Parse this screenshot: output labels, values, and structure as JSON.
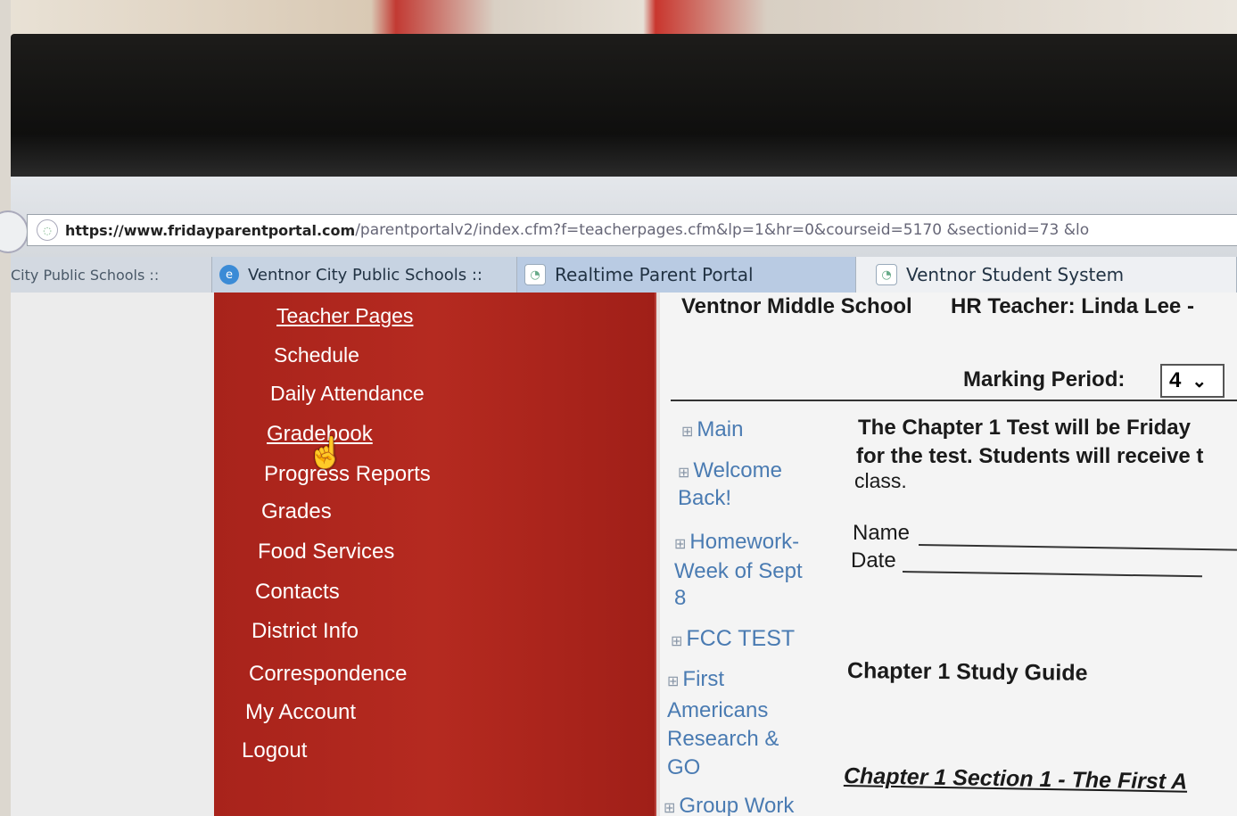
{
  "browser": {
    "url_prefix": "https://www.",
    "url_host": "fridayparentportal.com",
    "url_path": "/parentportalv2/index.cfm?f=teacherpages.cfm&lp=1&hr=0&courseid=5170 &sectionid=73 &lo",
    "tabs": [
      {
        "label": "City Public Schools ::"
      },
      {
        "label": "Ventnor City Public Schools ::"
      },
      {
        "label": "Realtime Parent Portal"
      },
      {
        "label": "Ventnor Student System"
      }
    ]
  },
  "nav": {
    "items": [
      {
        "label": "Teacher Pages"
      },
      {
        "label": "Schedule"
      },
      {
        "label": "Daily Attendance"
      },
      {
        "label": "Gradebook"
      },
      {
        "label": "Progress Reports"
      },
      {
        "label": "Grades"
      },
      {
        "label": "Food Services"
      },
      {
        "label": "Contacts"
      },
      {
        "label": "District Info"
      },
      {
        "label": "Correspondence"
      },
      {
        "label": "My Account"
      },
      {
        "label": "Logout"
      }
    ]
  },
  "header": {
    "school": "Ventnor Middle School",
    "teacher": "HR Teacher: Linda Lee -",
    "marking_period_label": "Marking Period:",
    "marking_period_value": "4"
  },
  "pages": [
    {
      "label": "Main"
    },
    {
      "label_line1": "Welcome",
      "label_line2": "Back!"
    },
    {
      "label_line1": "Homework-",
      "label_line2": "Week of Sept",
      "label_line3": "8"
    },
    {
      "label": "FCC TEST"
    },
    {
      "label_line1": "First",
      "label_line2": "Americans",
      "label_line3": "Research &",
      "label_line4": "GO"
    },
    {
      "label": "Group Work"
    }
  ],
  "body": {
    "line1": "The Chapter 1 Test will be Friday",
    "line2": "for the test. Students will receive t",
    "line3": "class.",
    "name_label": "Name",
    "date_label": "Date",
    "study_guide": "Chapter 1 Study Guide",
    "section_title": "Chapter 1 Section 1 - The First A"
  },
  "colors": {
    "nav_background": "#b02820",
    "link_blue": "#4a7bb2"
  },
  "icons": {
    "expand": "⊞",
    "dropdown": "chevron-down"
  }
}
